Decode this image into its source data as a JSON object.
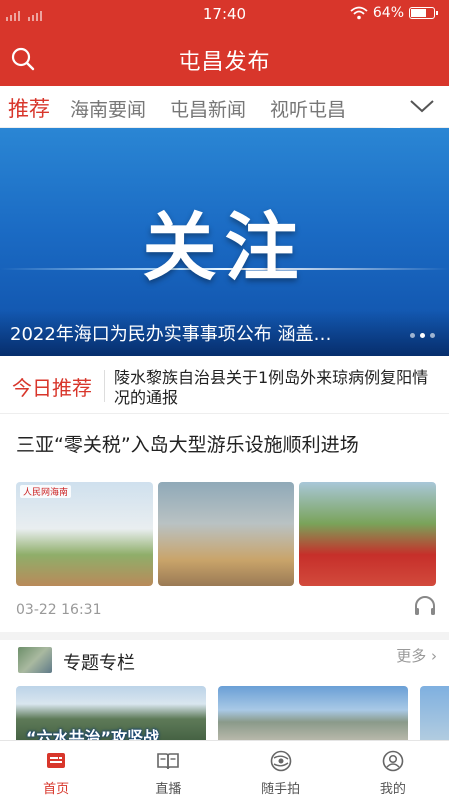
{
  "status_bar": {
    "time": "17:40",
    "battery": "64%"
  },
  "header": {
    "title": "屯昌发布"
  },
  "tabs": [
    {
      "label": "推荐",
      "active": true
    },
    {
      "label": "海南要闻",
      "active": false
    },
    {
      "label": "屯昌新闻",
      "active": false
    },
    {
      "label": "视听屯昌",
      "active": false
    }
  ],
  "banner": {
    "big_text": "关注",
    "caption": "2022年海口为民办实事事项公布 涵盖…"
  },
  "today_pick": {
    "label": "今日推荐",
    "text": "陵水黎族自治县关于1例岛外来琼病例复阳情况的通报"
  },
  "news": {
    "title": "三亚“零关税”入岛大型游乐设施顺利进场",
    "time": "03-22 16:31"
  },
  "topics": {
    "title": "专题专栏",
    "more": "更多",
    "card1_text": "“六水共治”攻坚战"
  },
  "bottom_nav": [
    {
      "label": "首页",
      "icon": "home-icon",
      "active": true
    },
    {
      "label": "直播",
      "icon": "live-icon",
      "active": false
    },
    {
      "label": "随手拍",
      "icon": "snapshot-icon",
      "active": false
    },
    {
      "label": "我的",
      "icon": "profile-icon",
      "active": false
    }
  ],
  "colors": {
    "accent": "#d8362b",
    "banner_blue": "#1b6bc4"
  }
}
